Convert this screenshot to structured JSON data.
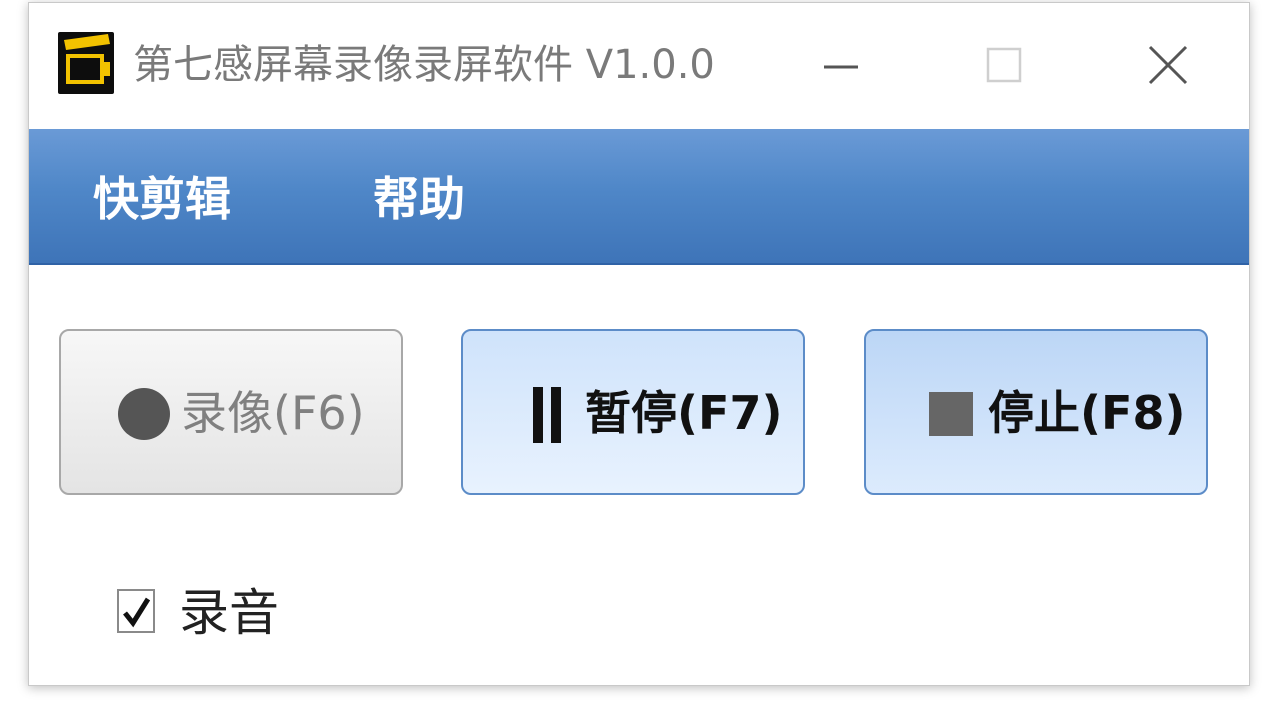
{
  "window": {
    "title": "第七感屏幕录像录屏软件 V1.0.0",
    "icon": "film-clapper-icon",
    "controls": {
      "minimize": "minimize-icon",
      "maximize": "maximize-icon",
      "close": "close-icon"
    }
  },
  "menu": {
    "items": [
      {
        "label": "快剪辑"
      },
      {
        "label": "帮助"
      }
    ]
  },
  "actions": {
    "record": {
      "label": "录像(F6)",
      "icon": "record-circle-icon",
      "enabled": false
    },
    "pause": {
      "label": "暂停(F7)",
      "icon": "pause-icon",
      "enabled": true
    },
    "stop": {
      "label": "停止(F8)",
      "icon": "stop-square-icon",
      "enabled": true
    }
  },
  "options": {
    "record_audio": {
      "label": "录音",
      "checked": true
    }
  },
  "colors": {
    "menubar": "#4f87c8",
    "title_text": "#7a7a7a",
    "button_border_active": "#5c8cc8",
    "button_disabled_text": "#808080",
    "icon_accent": "#f2c200"
  }
}
